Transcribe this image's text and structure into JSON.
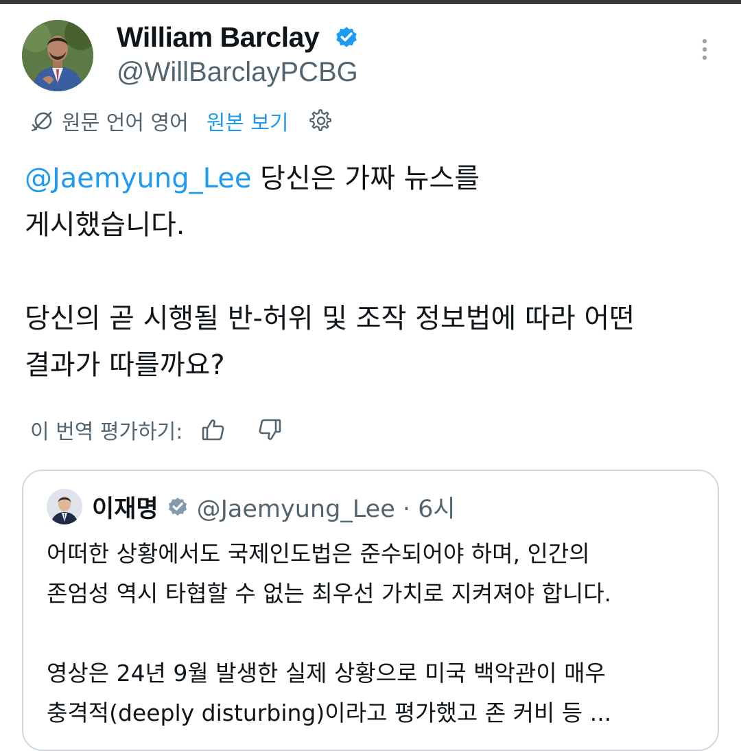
{
  "author": {
    "display_name": "William Barclay",
    "handle": "@WillBarclayPCBG",
    "verified": true
  },
  "translation_bar": {
    "source_language_text": "원문 언어 영어",
    "view_original_label": "원본 보기"
  },
  "tweet": {
    "mention": "@Jaemyung_Lee",
    "line1_rest": " 당신은 가짜 뉴스를",
    "line2": "게시했습니다.",
    "line3": "당신의 곧 시행될 반-허위 및 조작 정보법에 따라 어떤",
    "line4": "결과가 따를까요?"
  },
  "rating": {
    "label": "이 번역 평가하기:"
  },
  "quoted_tweet": {
    "display_name": "이재명",
    "handle_time": "@Jaemyung_Lee · 6시",
    "lines": [
      "어떠한 상황에서도 국제인도법은 준수되어야 하며, 인간의",
      "존엄성 역시 타협할 수 없는 최우선 가치로 지켜져야 합니다.",
      "영상은 24년 9월 발생한 실제 상황으로 미국 백악관이 매우",
      "충격적(deeply disturbing)이라고 평가했고 존 커비 등 ..."
    ]
  },
  "colors": {
    "accent": "#1d9bf0",
    "secondary_text": "#536471",
    "primary_text": "#0f1419",
    "border": "#cfd9de",
    "verified_author": "#1d9bf0",
    "verified_government": "#829aab"
  },
  "icons": {
    "avatar": "profile-photo",
    "verified": "verified-badge-icon",
    "more": "more-vertical-icon",
    "translate": "translate-icon",
    "settings": "settings-gear-icon",
    "thumbs_up": "thumbs-up-icon",
    "thumbs_down": "thumbs-down-icon"
  }
}
